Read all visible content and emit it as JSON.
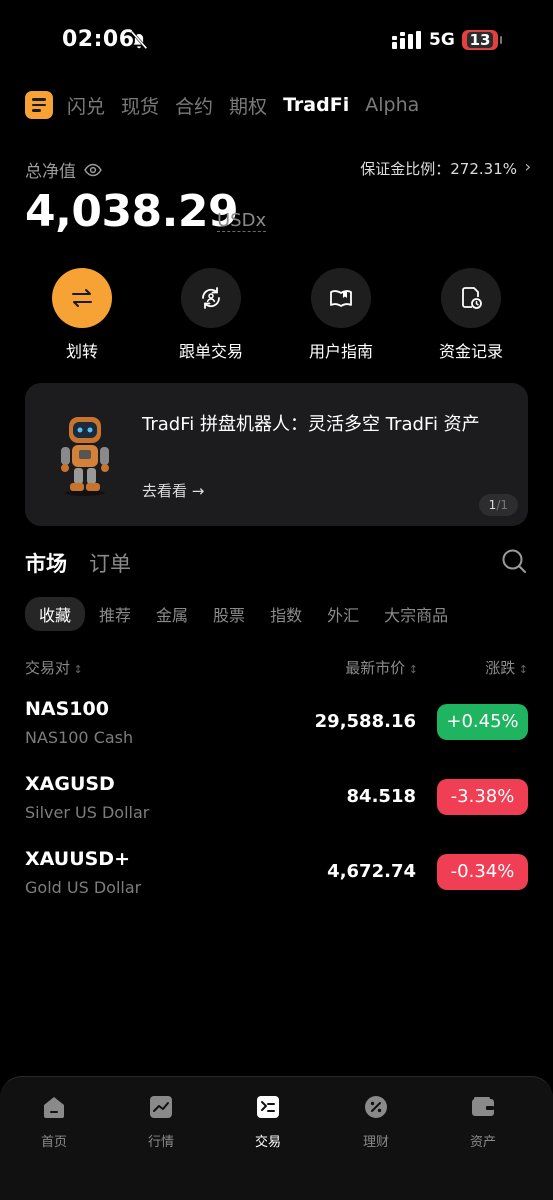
{
  "status": {
    "time": "02:06",
    "network": "5G",
    "battery": "13"
  },
  "topnav": {
    "tabs": [
      "闪兑",
      "现货",
      "合约",
      "期权",
      "TradFi",
      "Alpha"
    ],
    "active_index": 4
  },
  "equity": {
    "label": "总净值",
    "value": "4,038.29",
    "unit": "USDx",
    "margin_ratio": "保证金比例：272.31%"
  },
  "actions": [
    {
      "label": "划转",
      "icon": "transfer-icon"
    },
    {
      "label": "跟单交易",
      "icon": "copy-trade-icon"
    },
    {
      "label": "用户指南",
      "icon": "guide-icon"
    },
    {
      "label": "资金记录",
      "icon": "record-icon"
    }
  ],
  "banner": {
    "title": "TradFi 拼盘机器人：灵活多空 TradFi 资产",
    "link": "去看看",
    "page_current": "1",
    "page_total": "/1"
  },
  "market": {
    "tabs": [
      "市场",
      "订单"
    ],
    "chips": [
      "收藏",
      "推荐",
      "金属",
      "股票",
      "指数",
      "外汇",
      "大宗商品"
    ],
    "headers": {
      "pair": "交易对",
      "price": "最新市价",
      "change": "涨跌"
    },
    "rows": [
      {
        "symbol": "NAS100",
        "name": "NAS100 Cash",
        "price": "29,588.16",
        "change": "+0.45%",
        "dir": "up"
      },
      {
        "symbol": "XAGUSD",
        "name": "Silver US Dollar",
        "price": "84.518",
        "change": "-3.38%",
        "dir": "down"
      },
      {
        "symbol": "XAUUSD+",
        "name": "Gold US Dollar",
        "price": "4,672.74",
        "change": "-0.34%",
        "dir": "down"
      }
    ]
  },
  "bottom_nav": [
    "首页",
    "行情",
    "交易",
    "理财",
    "资产"
  ],
  "colors": {
    "accent": "#f7a234",
    "up": "#1fb45f",
    "down": "#f03f55"
  }
}
